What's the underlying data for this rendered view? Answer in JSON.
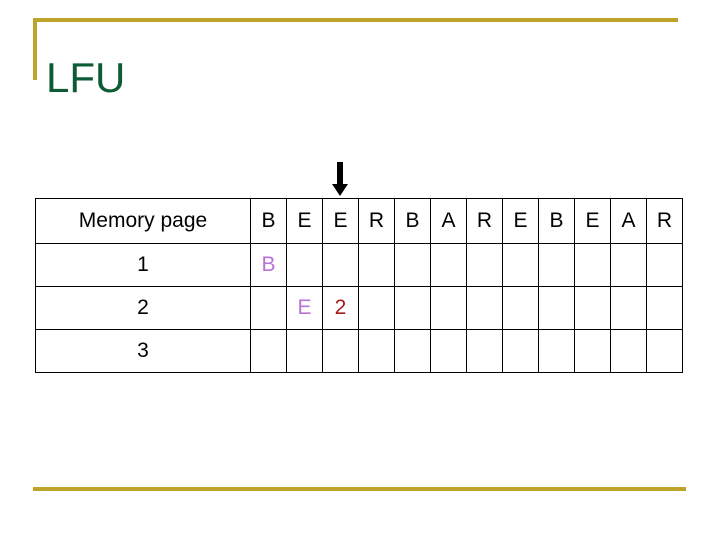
{
  "slide": {
    "title": "LFU",
    "title_color": "#0d5b33",
    "accent_color": "#bfa42a",
    "background": "#ffffff"
  },
  "pointer": {
    "icon": "down-arrow-icon",
    "target_column_index": 2,
    "color": "#000000"
  },
  "table": {
    "row_label_header": "Memory page",
    "reference_string": [
      "B",
      "E",
      "E",
      "R",
      "B",
      "A",
      "R",
      "E",
      "B",
      "E",
      "A",
      "R"
    ],
    "rows": [
      {
        "label": "1",
        "cells": [
          {
            "text": "B",
            "color": "#b972d6"
          },
          {
            "text": "",
            "color": "#000000"
          },
          {
            "text": "",
            "color": "#000000"
          },
          {
            "text": "",
            "color": "#000000"
          },
          {
            "text": "",
            "color": "#000000"
          },
          {
            "text": "",
            "color": "#000000"
          },
          {
            "text": "",
            "color": "#000000"
          },
          {
            "text": "",
            "color": "#000000"
          },
          {
            "text": "",
            "color": "#000000"
          },
          {
            "text": "",
            "color": "#000000"
          },
          {
            "text": "",
            "color": "#000000"
          },
          {
            "text": "",
            "color": "#000000"
          }
        ]
      },
      {
        "label": "2",
        "cells": [
          {
            "text": "",
            "color": "#000000"
          },
          {
            "text": "E",
            "color": "#b972d6"
          },
          {
            "text": "2",
            "color": "#a41b1b"
          },
          {
            "text": "",
            "color": "#000000"
          },
          {
            "text": "",
            "color": "#000000"
          },
          {
            "text": "",
            "color": "#000000"
          },
          {
            "text": "",
            "color": "#000000"
          },
          {
            "text": "",
            "color": "#000000"
          },
          {
            "text": "",
            "color": "#000000"
          },
          {
            "text": "",
            "color": "#000000"
          },
          {
            "text": "",
            "color": "#000000"
          },
          {
            "text": "",
            "color": "#000000"
          }
        ]
      },
      {
        "label": "3",
        "cells": [
          {
            "text": "",
            "color": "#000000"
          },
          {
            "text": "",
            "color": "#000000"
          },
          {
            "text": "",
            "color": "#000000"
          },
          {
            "text": "",
            "color": "#000000"
          },
          {
            "text": "",
            "color": "#000000"
          },
          {
            "text": "",
            "color": "#000000"
          },
          {
            "text": "",
            "color": "#000000"
          },
          {
            "text": "",
            "color": "#000000"
          },
          {
            "text": "",
            "color": "#000000"
          },
          {
            "text": "",
            "color": "#000000"
          },
          {
            "text": "",
            "color": "#000000"
          },
          {
            "text": "",
            "color": "#000000"
          }
        ]
      }
    ]
  }
}
